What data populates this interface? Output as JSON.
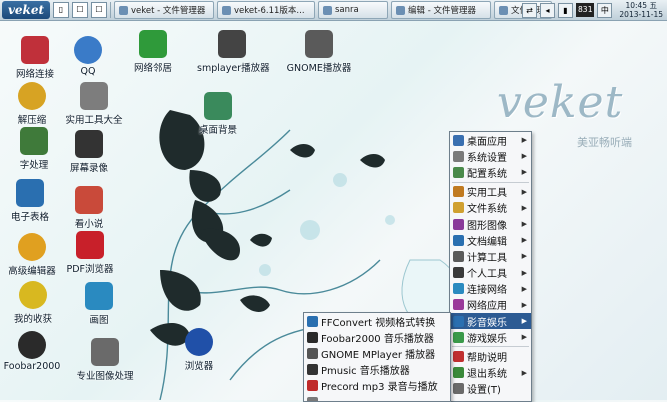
{
  "taskbar": {
    "start_label": "veket",
    "quick_icons": [
      "▯",
      "☐",
      "☐"
    ],
    "tasks": [
      {
        "label": "veket - 文件管理器"
      },
      {
        "label": "veket-6.11版本..."
      },
      {
        "label": "sanra"
      },
      {
        "label": "编辑 - 文件管理器"
      },
      {
        "label": "文件管理器"
      }
    ],
    "tray": {
      "num": "831",
      "clock_line1": "10:45 五",
      "clock_line2": "2013-11-15"
    }
  },
  "brand": {
    "logo": "veket",
    "subtitle": "美亚畅听端"
  },
  "desktop_icons": [
    {
      "label": "网络连接",
      "color": "#c0303a"
    },
    {
      "label": "QQ",
      "color": "#3a7bc8"
    },
    {
      "label": "网络邻居",
      "color": "#2f9a3a"
    },
    {
      "label": "smplayer播放器",
      "color": "#444444"
    },
    {
      "label": "GNOME播放器",
      "color": "#5a5a5a"
    },
    {
      "label": "解压缩",
      "color": "#d7a323"
    },
    {
      "label": "实用工具大全",
      "color": "#7d7d7d"
    },
    {
      "label": "桌面背景",
      "color": "#3a8a5c"
    },
    {
      "label": "字处理",
      "color": "#3f7a3a"
    },
    {
      "label": "屏幕录像",
      "color": "#333333"
    },
    {
      "label": "电子表格",
      "color": "#2a6fb0"
    },
    {
      "label": "看小说",
      "color": "#c94a3a"
    },
    {
      "label": "高级编辑器",
      "color": "#e0a020"
    },
    {
      "label": "PDF浏览器",
      "color": "#c8202a"
    },
    {
      "label": "我的收获",
      "color": "#d8b820"
    },
    {
      "label": "画图",
      "color": "#2a8ac0"
    },
    {
      "label": "Foobar2000",
      "color": "#2a2a2a"
    },
    {
      "label": "专业图像处理",
      "color": "#6a6a6a"
    },
    {
      "label": "浏览器",
      "color": "#2050a8"
    }
  ],
  "main_menu": [
    {
      "label": "桌面应用",
      "color": "#3a6fb0",
      "arrow": true
    },
    {
      "label": "系统设置",
      "color": "#7a7a7a",
      "arrow": true
    },
    {
      "label": "配置系统",
      "color": "#4a8a4a",
      "arrow": true
    },
    {
      "sep": true
    },
    {
      "label": "实用工具",
      "color": "#c07a20",
      "arrow": true
    },
    {
      "label": "文件系统",
      "color": "#d0a030",
      "arrow": true
    },
    {
      "label": "图形图像",
      "color": "#8a3a9a",
      "arrow": true
    },
    {
      "label": "文档编辑",
      "color": "#2a6fb0",
      "arrow": true
    },
    {
      "label": "计算工具",
      "color": "#5a5a5a",
      "arrow": true
    },
    {
      "label": "个人工具",
      "color": "#3a3a3a",
      "arrow": true
    },
    {
      "label": "连接网络",
      "color": "#2a8ac0",
      "arrow": true
    },
    {
      "label": "网络应用",
      "color": "#9a3a9a",
      "arrow": true
    },
    {
      "label": "影音娱乐",
      "color": "#2a6fb0",
      "arrow": true,
      "active": true
    },
    {
      "label": "游戏娱乐",
      "color": "#3a9a4a",
      "arrow": true
    },
    {
      "sep": true
    },
    {
      "label": "帮助说明",
      "color": "#c03030",
      "arrow": false
    },
    {
      "label": "退出系统",
      "color": "#3a8a3a",
      "arrow": true
    },
    {
      "label": "设置(T)",
      "color": "#6a6a6a",
      "arrow": false
    }
  ],
  "sub_menu": [
    {
      "label": "FFConvert 视频格式转换",
      "color": "#2a6fb0"
    },
    {
      "label": "Foobar2000 音乐播放器",
      "color": "#2a2a2a"
    },
    {
      "label": "GNOME MPlayer 播放器",
      "color": "#555555"
    },
    {
      "label": "Pmusic 音乐播放器",
      "color": "#333333"
    },
    {
      "label": "Precord mp3 录音与播放",
      "color": "#c02a2a"
    },
    {
      "label": "...",
      "color": "#7a7a7a"
    }
  ]
}
